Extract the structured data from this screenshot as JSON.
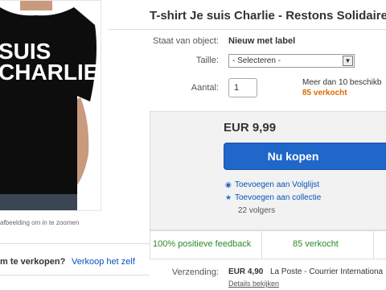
{
  "listing": {
    "title": "T-shirt Je suis Charlie - Restons Solidaire",
    "image_alt_text_lines": [
      "SUIS",
      "CHARLIE"
    ],
    "zoom_hint": "afbeelding om in te zoomen"
  },
  "details": {
    "condition_label": "Staat van object:",
    "condition_value": "Nieuw met label",
    "size_label": "Taille:",
    "size_selected": "- Selecteren -",
    "quantity_label": "Aantal:",
    "quantity_value": "1",
    "availability": "Meer dan 10 beschikb",
    "sold_count": "85 verkocht"
  },
  "buy": {
    "price": "EUR 9,99",
    "buy_now_label": "Nu kopen",
    "watchlist_label": "Toevoegen aan Volglijst",
    "collection_label": "Toevoegen aan collectie",
    "followers": "22 volgers"
  },
  "stats": {
    "feedback": "100% positieve feedback",
    "sold": "85 verkocht"
  },
  "shipping": {
    "label": "Verzending:",
    "price": "EUR 4,90",
    "method": "La Poste - Courrier Internationa",
    "details_link": "Details bekijken"
  },
  "sell": {
    "question": "m te verkopen?",
    "link": "Verkoop het zelf"
  },
  "colors": {
    "buy_button": "#1f67c9",
    "link": "#0654ba",
    "sold_orange": "#dd6a00",
    "positive_green": "#2a8a2a"
  }
}
